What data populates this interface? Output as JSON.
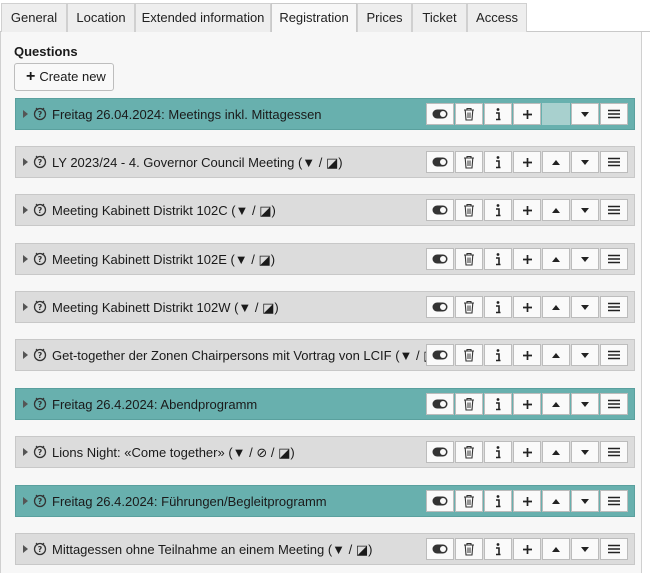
{
  "tabs": [
    {
      "label": "General"
    },
    {
      "label": "Location"
    },
    {
      "label": "Extended information"
    },
    {
      "label": "Registration"
    },
    {
      "label": "Prices"
    },
    {
      "label": "Ticket"
    },
    {
      "label": "Access"
    }
  ],
  "active_tab": "Registration",
  "section_title": "Questions",
  "create_label": "Create new",
  "rows": [
    {
      "title": "Freitag 26.04.2024: Meetings inkl. Mittagessen",
      "highlighted": true,
      "first": true
    },
    {
      "title": "LY 2023/24 - 4. Governor Council Meeting (▼ / ◪)",
      "highlighted": false
    },
    {
      "title": "Meeting Kabinett Distrikt 102C (▼ / ◪)",
      "highlighted": false
    },
    {
      "title": "Meeting Kabinett Distrikt 102E (▼ / ◪)",
      "highlighted": false
    },
    {
      "title": "Meeting Kabinett Distrikt 102W (▼ / ◪)",
      "highlighted": false
    },
    {
      "title": "Get-together der Zonen Chairpersons mit Vortrag von LCIF (▼ / ◪)",
      "highlighted": false
    },
    {
      "title": "Freitag 26.4.2024: Abendprogramm",
      "highlighted": true
    },
    {
      "title": "Lions Night: «Come together» (▼ / ⊘ / ◪)",
      "highlighted": false
    },
    {
      "title": "Freitag 26.4.2024: Führungen/Begleitprogramm",
      "highlighted": true
    },
    {
      "title": "Mittagessen ohne Teilnahme an einem Meeting (▼ / ◪)",
      "highlighted": false
    }
  ],
  "colors": {
    "highlight": "#68b0ae",
    "row": "#dcdcdc"
  },
  "icons": [
    "toggle-icon",
    "trash-icon",
    "info-icon",
    "plus-icon",
    "arrow-up-icon",
    "arrow-down-icon",
    "drag-handle-icon"
  ]
}
